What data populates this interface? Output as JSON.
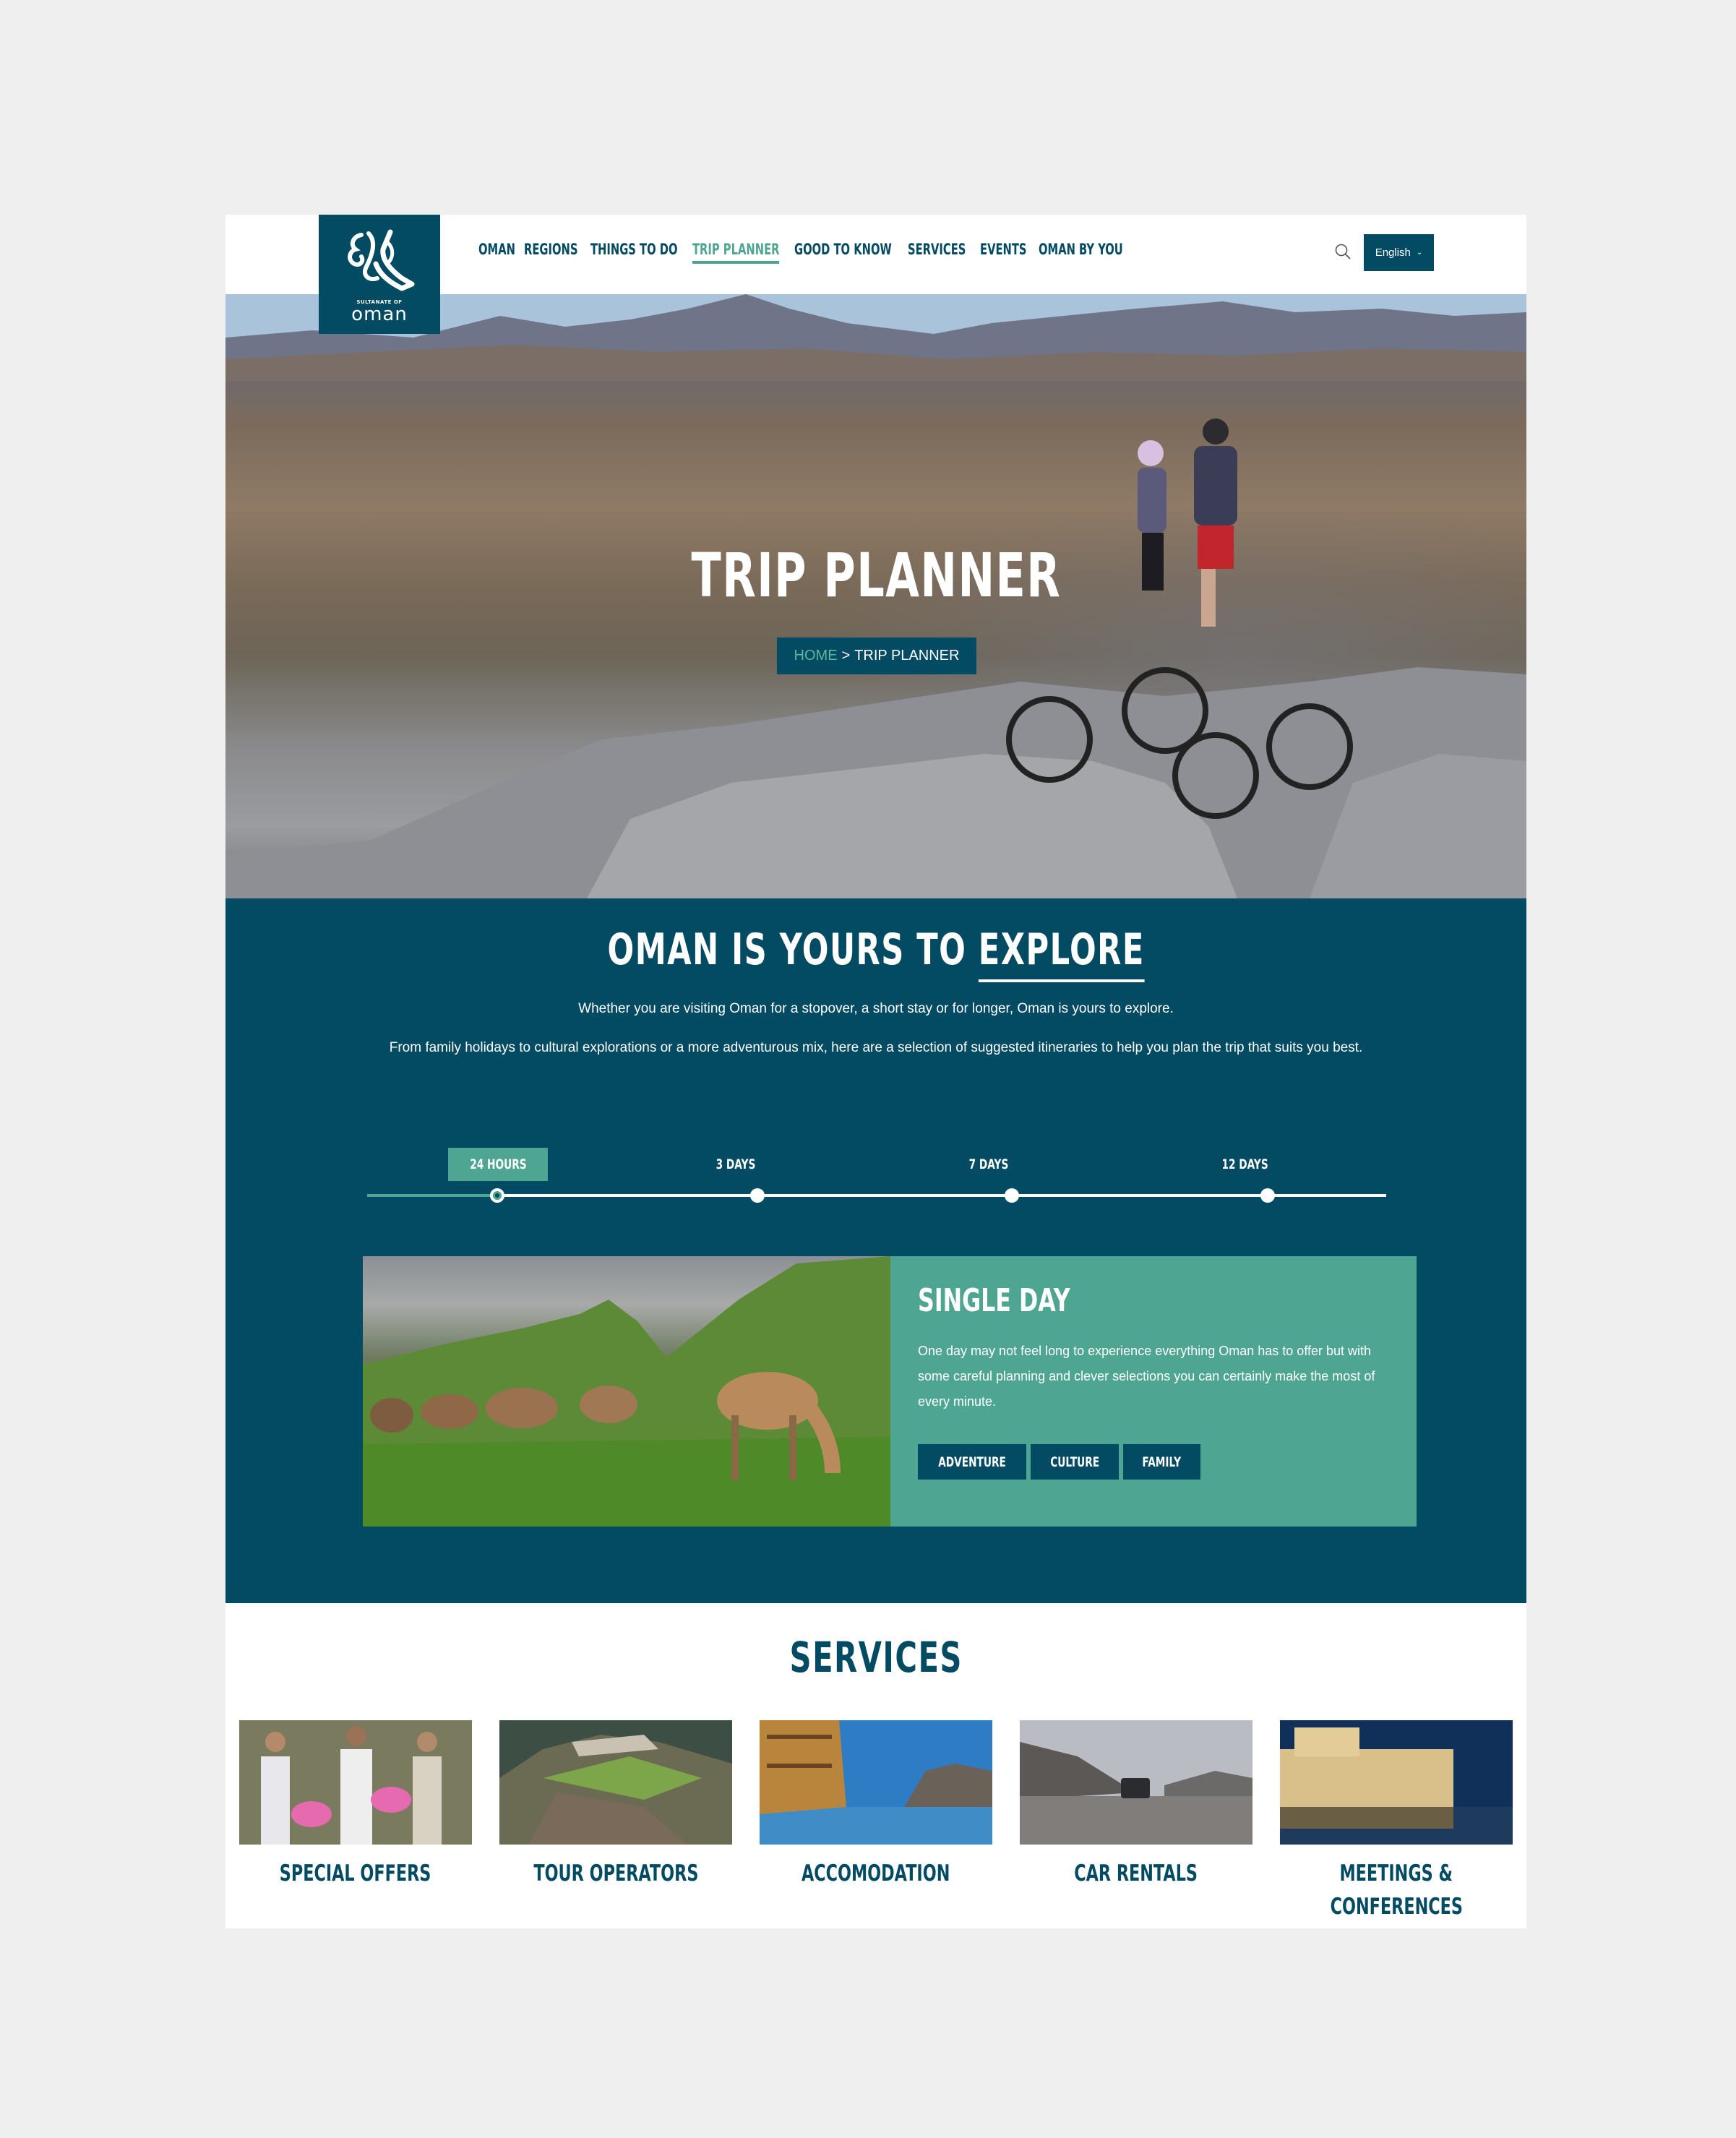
{
  "brand": {
    "logo_subtitle": "SULTANATE OF",
    "logo_name": "oman",
    "primary_color": "#034a63",
    "accent_color": "#4ea591"
  },
  "nav": {
    "items": [
      {
        "label": "OMAN",
        "active": false
      },
      {
        "label": "REGIONS",
        "active": false
      },
      {
        "label": "THINGS TO DO",
        "active": false
      },
      {
        "label": "TRIP PLANNER",
        "active": true
      },
      {
        "label": "GOOD TO KNOW",
        "active": false
      },
      {
        "label": "SERVICES",
        "active": false
      },
      {
        "label": "EVENTS",
        "active": false
      },
      {
        "label": "OMAN BY YOU",
        "active": false
      }
    ],
    "search_icon": "search-icon",
    "language": "English"
  },
  "hero": {
    "title": "TRIP PLANNER",
    "breadcrumb": {
      "home": "HOME",
      "separator": ">",
      "current": "TRIP PLANNER"
    }
  },
  "explore": {
    "title_prefix": "OMAN IS YOURS TO",
    "title_highlight": "EXPLORE",
    "paragraph1": "Whether you are visiting Oman for a stopover, a short stay or for longer, Oman is yours to explore.",
    "paragraph2": "From family holidays to cultural explorations or a more adventurous mix, here are a selection of suggested itineraries to help you plan the trip that suits you best.",
    "timeline": [
      {
        "label": "24 HOURS",
        "active": true
      },
      {
        "label": "3 DAYS",
        "active": false
      },
      {
        "label": "7 DAYS",
        "active": false
      },
      {
        "label": "12 DAYS",
        "active": false
      }
    ],
    "card": {
      "image_alt": "Camels grazing on green mountain slopes",
      "title": "SINGLE DAY",
      "description": "One day may not feel long to experience everything Oman has to offer but with some careful planning and clever selections you can certainly make the most of every minute.",
      "tags": [
        "ADVENTURE",
        "CULTURE",
        "FAMILY"
      ]
    }
  },
  "services": {
    "title": "SERVICES",
    "items": [
      {
        "label": "SPECIAL OFFERS",
        "image_alt": "Men holding baskets of roses"
      },
      {
        "label": "TOUR OPERATORS",
        "image_alt": "Terraced mountain village"
      },
      {
        "label": "ACCOMODATION",
        "image_alt": "Hotel by the water"
      },
      {
        "label": "CAR RENTALS",
        "image_alt": "4x4 crossing a wadi"
      },
      {
        "label": "MEETINGS &",
        "label2": "CONFERENCES",
        "image_alt": "Royal Opera House at night"
      }
    ]
  }
}
